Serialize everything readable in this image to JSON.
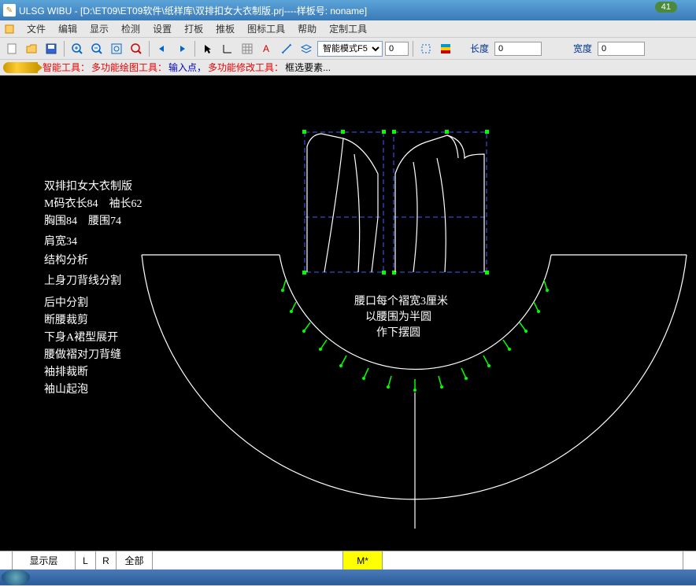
{
  "titlebar": {
    "title": "ULSG WIBU - [D:\\ET09\\ET09软件\\纸样库\\双排扣女大衣制版.prj----样板号: noname]",
    "badge": "41"
  },
  "menu": {
    "items": [
      "文件",
      "编辑",
      "显示",
      "检测",
      "设置",
      "打板",
      "推板",
      "图标工具",
      "帮助",
      "定制工具"
    ]
  },
  "toolbar": {
    "dropdown": "智能模式F5",
    "spin_value": "0",
    "length_label": "长度",
    "length_value": "0",
    "width_label": "宽度",
    "width_value": "0"
  },
  "toolstrip": {
    "t1": "智能工具：",
    "t2": "多功能绘图工具：",
    "t3": "输入点，",
    "t4": "多功能修改工具：",
    "t5": "框选要素..."
  },
  "canvas_text": {
    "left": [
      "双排扣女大衣制版",
      "M码衣长84　袖长62",
      "胸围84　腰围74",
      "肩宽34",
      "结构分析",
      "上身刀背线分割",
      "后中分割",
      "断腰裁剪",
      "下身A裙型展开",
      "腰做褶对刀背缝",
      "袖排裁断",
      "袖山起泡"
    ],
    "center": [
      "腰口每个褶宽3厘米",
      "以腰围为半圆",
      "作下摆圆"
    ]
  },
  "statusbar": {
    "show_layer": "显示层",
    "l": "L",
    "r": "R",
    "all": "全部",
    "m": "M*"
  }
}
